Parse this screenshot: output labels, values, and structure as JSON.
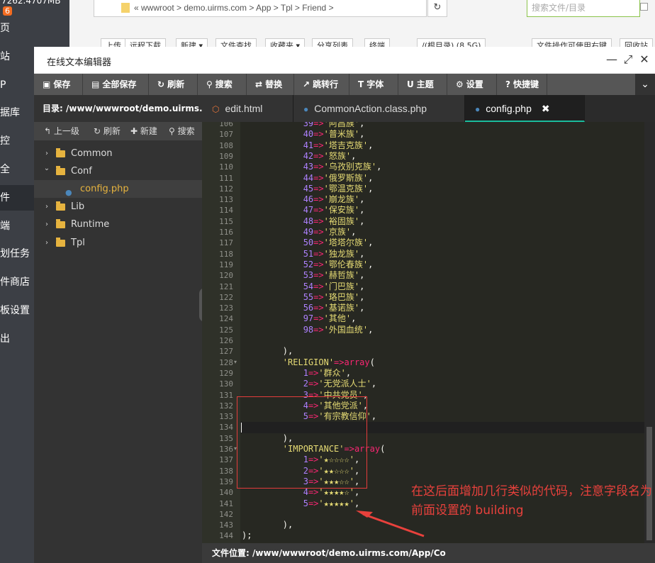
{
  "left_nav": {
    "top_text": "7262.4707MB",
    "top_badge": "6",
    "items": [
      {
        "label": "页",
        "icon": "home-icon"
      },
      {
        "label": "站",
        "icon": "site-icon"
      },
      {
        "label": "P",
        "icon": "ftp-icon"
      },
      {
        "label": "据库",
        "icon": "database-icon"
      },
      {
        "label": "控",
        "icon": "monitor-icon"
      },
      {
        "label": "全",
        "icon": "security-icon"
      },
      {
        "label": "件",
        "icon": "files-icon"
      },
      {
        "label": "端",
        "icon": "terminal-icon"
      },
      {
        "label": "划任务",
        "icon": "cron-icon"
      },
      {
        "label": "件商店",
        "icon": "store-icon"
      },
      {
        "label": "板设置",
        "icon": "settings-icon"
      },
      {
        "label": "出",
        "icon": "logout-icon"
      }
    ]
  },
  "browser": {
    "breadcrumb": "«  wwwroot  >  demo.uirms.com  >  App  >  Tpl  >  Friend  >",
    "search_placeholder": "搜索文件/目录",
    "toolbar_buttons": [
      "上传",
      "远程下载",
      "新建 ▾",
      "文件查找",
      "收藏夹 ▾",
      "分享列表",
      "终端",
      "/(根目录) (8.5G)",
      "文件操作可使用右键",
      "回收站"
    ]
  },
  "window": {
    "title": "在线文本编辑器",
    "controls": {
      "minimize": "—",
      "maximize": "⤢",
      "close": "✕"
    }
  },
  "toolbar": [
    {
      "label": "保存",
      "icon": "save-icon",
      "glyph": "▣"
    },
    {
      "label": "全部保存",
      "icon": "save-all-icon",
      "glyph": "▤"
    },
    {
      "label": "刷新",
      "icon": "refresh-icon",
      "glyph": "↻"
    },
    {
      "label": "搜索",
      "icon": "search-icon",
      "glyph": "⚲"
    },
    {
      "label": "替换",
      "icon": "replace-icon",
      "glyph": "⇄"
    },
    {
      "label": "跳转行",
      "icon": "goto-line-icon",
      "glyph": "↗"
    },
    {
      "label": "字体",
      "icon": "font-icon",
      "glyph": "T"
    },
    {
      "label": "主题",
      "icon": "theme-icon",
      "glyph": "U"
    },
    {
      "label": "设置",
      "icon": "gear-icon",
      "glyph": "⚙"
    },
    {
      "label": "快捷键",
      "icon": "help-icon",
      "glyph": "?"
    }
  ],
  "sidebar": {
    "directory": "目录: /www/wwwroot/demo.uirms.c...",
    "ops": [
      {
        "label": "上一级",
        "icon": "up-icon",
        "glyph": "↰"
      },
      {
        "label": "刷新",
        "icon": "refresh-icon",
        "glyph": "↻"
      },
      {
        "label": "新建",
        "icon": "plus-icon",
        "glyph": "✚"
      },
      {
        "label": "搜索",
        "icon": "search-icon",
        "glyph": "⚲"
      }
    ],
    "tree": [
      {
        "label": "Common",
        "type": "folder",
        "expanded": false
      },
      {
        "label": "Conf",
        "type": "folder",
        "expanded": true
      },
      {
        "label": "config.php",
        "type": "file",
        "selected": true
      },
      {
        "label": "Lib",
        "type": "folder",
        "expanded": false
      },
      {
        "label": "Runtime",
        "type": "folder",
        "expanded": false
      },
      {
        "label": "Tpl",
        "type": "folder",
        "expanded": false
      }
    ]
  },
  "tabs": [
    {
      "label": "edit.html",
      "icon": "html5-icon",
      "glyph": "⬡",
      "active": false
    },
    {
      "label": "CommonAction.class.php",
      "icon": "php-icon",
      "glyph": "●",
      "active": false
    },
    {
      "label": "config.php",
      "icon": "php-icon",
      "glyph": "●",
      "active": true,
      "close": "✖"
    }
  ],
  "editor": {
    "active_line": 134,
    "lines": [
      {
        "n": "106",
        "indent": "            ",
        "k": "39",
        "v": "'阿昌族'"
      },
      {
        "n": "107",
        "indent": "            ",
        "k": "40",
        "v": "'普米族'"
      },
      {
        "n": "108",
        "indent": "            ",
        "k": "41",
        "v": "'塔吉克族'"
      },
      {
        "n": "109",
        "indent": "            ",
        "k": "42",
        "v": "'怒族'"
      },
      {
        "n": "110",
        "indent": "            ",
        "k": "43",
        "v": "'乌孜别克族'"
      },
      {
        "n": "111",
        "indent": "            ",
        "k": "44",
        "v": "'俄罗斯族'"
      },
      {
        "n": "112",
        "indent": "            ",
        "k": "45",
        "v": "'鄂温克族'"
      },
      {
        "n": "113",
        "indent": "            ",
        "k": "46",
        "v": "'崩龙族'"
      },
      {
        "n": "114",
        "indent": "            ",
        "k": "47",
        "v": "'保安族'"
      },
      {
        "n": "115",
        "indent": "            ",
        "k": "48",
        "v": "'裕固族'"
      },
      {
        "n": "116",
        "indent": "            ",
        "k": "49",
        "v": "'京族'"
      },
      {
        "n": "117",
        "indent": "            ",
        "k": "50",
        "v": "'塔塔尔族'"
      },
      {
        "n": "118",
        "indent": "            ",
        "k": "51",
        "v": "'独龙族'"
      },
      {
        "n": "119",
        "indent": "            ",
        "k": "52",
        "v": "'鄂伦春族'"
      },
      {
        "n": "120",
        "indent": "            ",
        "k": "53",
        "v": "'赫哲族'"
      },
      {
        "n": "121",
        "indent": "            ",
        "k": "54",
        "v": "'门巴族'"
      },
      {
        "n": "122",
        "indent": "            ",
        "k": "55",
        "v": "'珞巴族'"
      },
      {
        "n": "123",
        "indent": "            ",
        "k": "56",
        "v": "'基诺族'"
      },
      {
        "n": "124",
        "indent": "            ",
        "k": "97",
        "v": "'其他'"
      },
      {
        "n": "125",
        "indent": "            ",
        "k": "98",
        "v": "'外国血统'"
      },
      {
        "n": "126",
        "raw": ""
      },
      {
        "n": "127",
        "raw": "        ),"
      },
      {
        "n": "128",
        "fold": true,
        "indent": "        ",
        "key": "'RELIGION'",
        "arr": "array",
        "tail": "("
      },
      {
        "n": "129",
        "indent": "            ",
        "k": "1",
        "v": "'群众'"
      },
      {
        "n": "130",
        "indent": "            ",
        "k": "2",
        "v": "'无党派人士'"
      },
      {
        "n": "131",
        "indent": "            ",
        "k": "3",
        "v": "'中共党员'"
      },
      {
        "n": "132",
        "indent": "            ",
        "k": "4",
        "v": "'其他党派'"
      },
      {
        "n": "133",
        "indent": "            ",
        "k": "5",
        "v": "'有宗教信仰'"
      },
      {
        "n": "134",
        "raw": ""
      },
      {
        "n": "135",
        "raw": "        ),"
      },
      {
        "n": "136",
        "fold": true,
        "indent": "        ",
        "key": "'IMPORTANCE'",
        "arr": "array",
        "tail": "("
      },
      {
        "n": "137",
        "indent": "            ",
        "k": "1",
        "v": "'★☆☆☆☆'"
      },
      {
        "n": "138",
        "indent": "            ",
        "k": "2",
        "v": "'★★☆☆☆'"
      },
      {
        "n": "139",
        "indent": "            ",
        "k": "3",
        "v": "'★★★☆☆'"
      },
      {
        "n": "140",
        "indent": "            ",
        "k": "4",
        "v": "'★★★★☆'"
      },
      {
        "n": "141",
        "indent": "            ",
        "k": "5",
        "v": "'★★★★★'"
      },
      {
        "n": "142",
        "raw": ""
      },
      {
        "n": "143",
        "raw": "        ),"
      },
      {
        "n": "144",
        "raw": ");"
      }
    ]
  },
  "status": "文件位置: /www/wwwroot/demo.uirms.com/App/Co",
  "annotation": "在这后面增加几行类似的代码，注意字段名为前面设置的 building",
  "colors": {
    "accent": "#1abc9c",
    "annotation": "#e8413c",
    "editor_bg": "#272822",
    "string": "#e6db74",
    "number": "#ae81ff",
    "operator": "#f92672"
  }
}
